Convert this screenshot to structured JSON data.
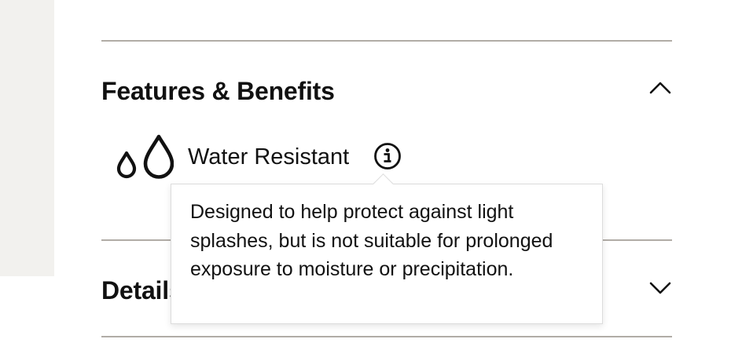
{
  "accordion": {
    "features": {
      "title": "Features & Benefits",
      "expanded": true,
      "toggle_icon": "chevron-up-icon",
      "items": [
        {
          "icon": "water-drops-icon",
          "label": "Water Resistant",
          "info_icon": "info-icon",
          "tooltip": "Designed to help protect against light splashes, but is not suitable for prolonged exposure to moisture or precipitation."
        }
      ]
    },
    "details": {
      "title": "Details",
      "expanded": false,
      "toggle_icon": "chevron-down-icon"
    }
  },
  "colors": {
    "text": "#111111",
    "divider": "#b1aca6",
    "side_panel": "#f2f1ee",
    "tooltip_border": "#dcdcdc"
  }
}
